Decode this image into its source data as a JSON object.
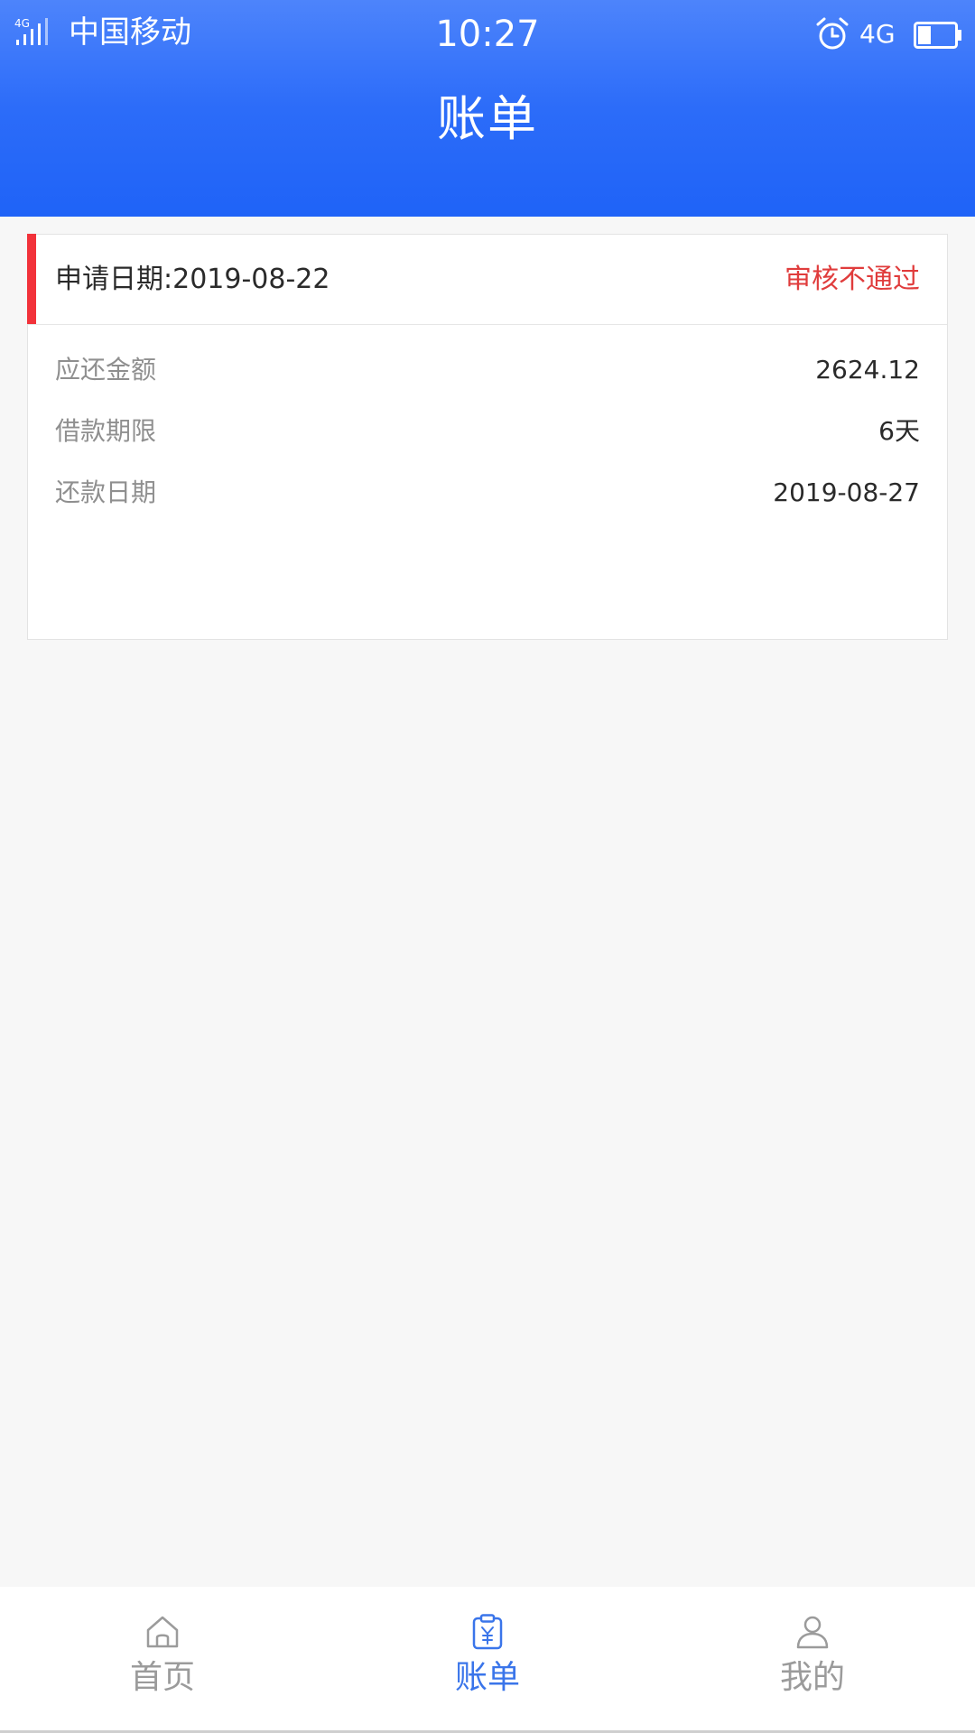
{
  "status_bar": {
    "network_badge": "4G",
    "carrier": "中国移动",
    "time": "10:27",
    "network": "4G"
  },
  "header": {
    "title": "账单"
  },
  "bill_card": {
    "apply_date": "申请日期:2019-08-22",
    "status": "审核不通过",
    "status_color": "#e03c3c",
    "accent_color": "#f2323a",
    "rows": [
      {
        "label": "应还金额",
        "value": "2624.12"
      },
      {
        "label": "借款期限",
        "value": "6天"
      },
      {
        "label": "还款日期",
        "value": "2019-08-27"
      }
    ]
  },
  "bottom_nav": {
    "active_index": 1,
    "active_color": "#3a75ea",
    "items": [
      {
        "label": "首页",
        "icon": "home-icon"
      },
      {
        "label": "账单",
        "icon": "bill-icon"
      },
      {
        "label": "我的",
        "icon": "user-icon"
      }
    ]
  },
  "colors": {
    "header_gradient_top": "#4d84fb",
    "header_gradient_bottom": "#1f63f7",
    "background": "#f7f7f7"
  }
}
